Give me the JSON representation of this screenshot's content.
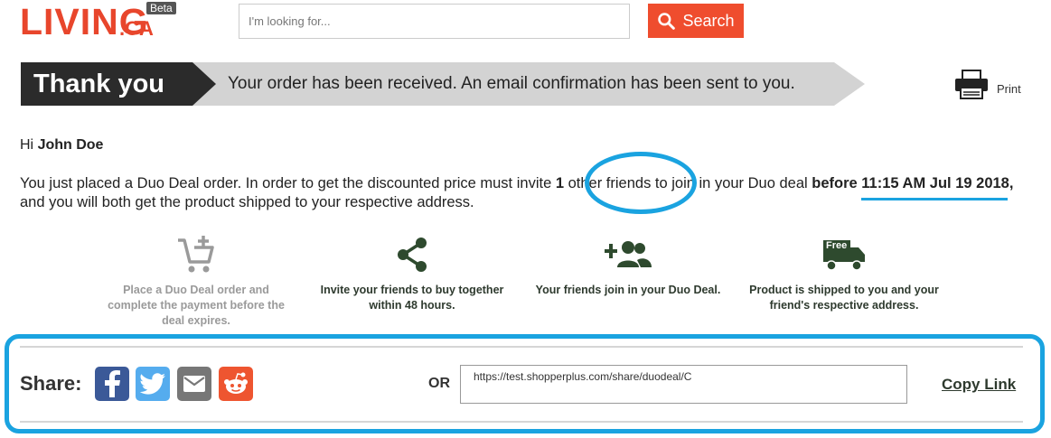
{
  "header": {
    "logo_main": "LIVING",
    "logo_ca": ".CA",
    "logo_beta": "Beta",
    "search_placeholder": "I'm looking for...",
    "search_button_label": "Search"
  },
  "banner": {
    "title": "Thank you",
    "message": "Your order has been received. An email confirmation has been sent to you."
  },
  "print_label": "Print",
  "greeting": {
    "prefix": "Hi",
    "name": "John Doe"
  },
  "message": {
    "part1": "You just placed a Duo Deal order. In order to get the discounted price must invite ",
    "friend_count": "1",
    "part2": " other friends to join in your Duo deal ",
    "deadline": "before 11:15 AM Jul 19 2018,",
    "part3": " and you will both get the product shipped to your respective address."
  },
  "steps": [
    {
      "icon": "cart-add-icon",
      "text": "Place a Duo Deal order and complete the payment before the deal expires."
    },
    {
      "icon": "share-icon",
      "text": "Invite your friends to buy together within 48 hours."
    },
    {
      "icon": "add-friends-icon",
      "text": "Your friends join in your Duo Deal."
    },
    {
      "icon": "free-shipping-truck-icon",
      "text": "Product is shipped to you and your friend's respective address.",
      "badge": "Free"
    }
  ],
  "share": {
    "label": "Share:",
    "or_label": "OR",
    "url": "https://test.shopperplus.com/share/duodeal/C",
    "copy_link_label": "Copy Link",
    "networks": [
      "facebook-icon",
      "twitter-icon",
      "email-icon",
      "reddit-icon"
    ]
  },
  "colors": {
    "brand": "#e8462c",
    "search_button": "#ef4d2e",
    "annotation": "#1aa3e0",
    "banner_dark": "#2b2b2b",
    "banner_light": "#d3d3d3",
    "step_active": "#2e4a2e"
  }
}
